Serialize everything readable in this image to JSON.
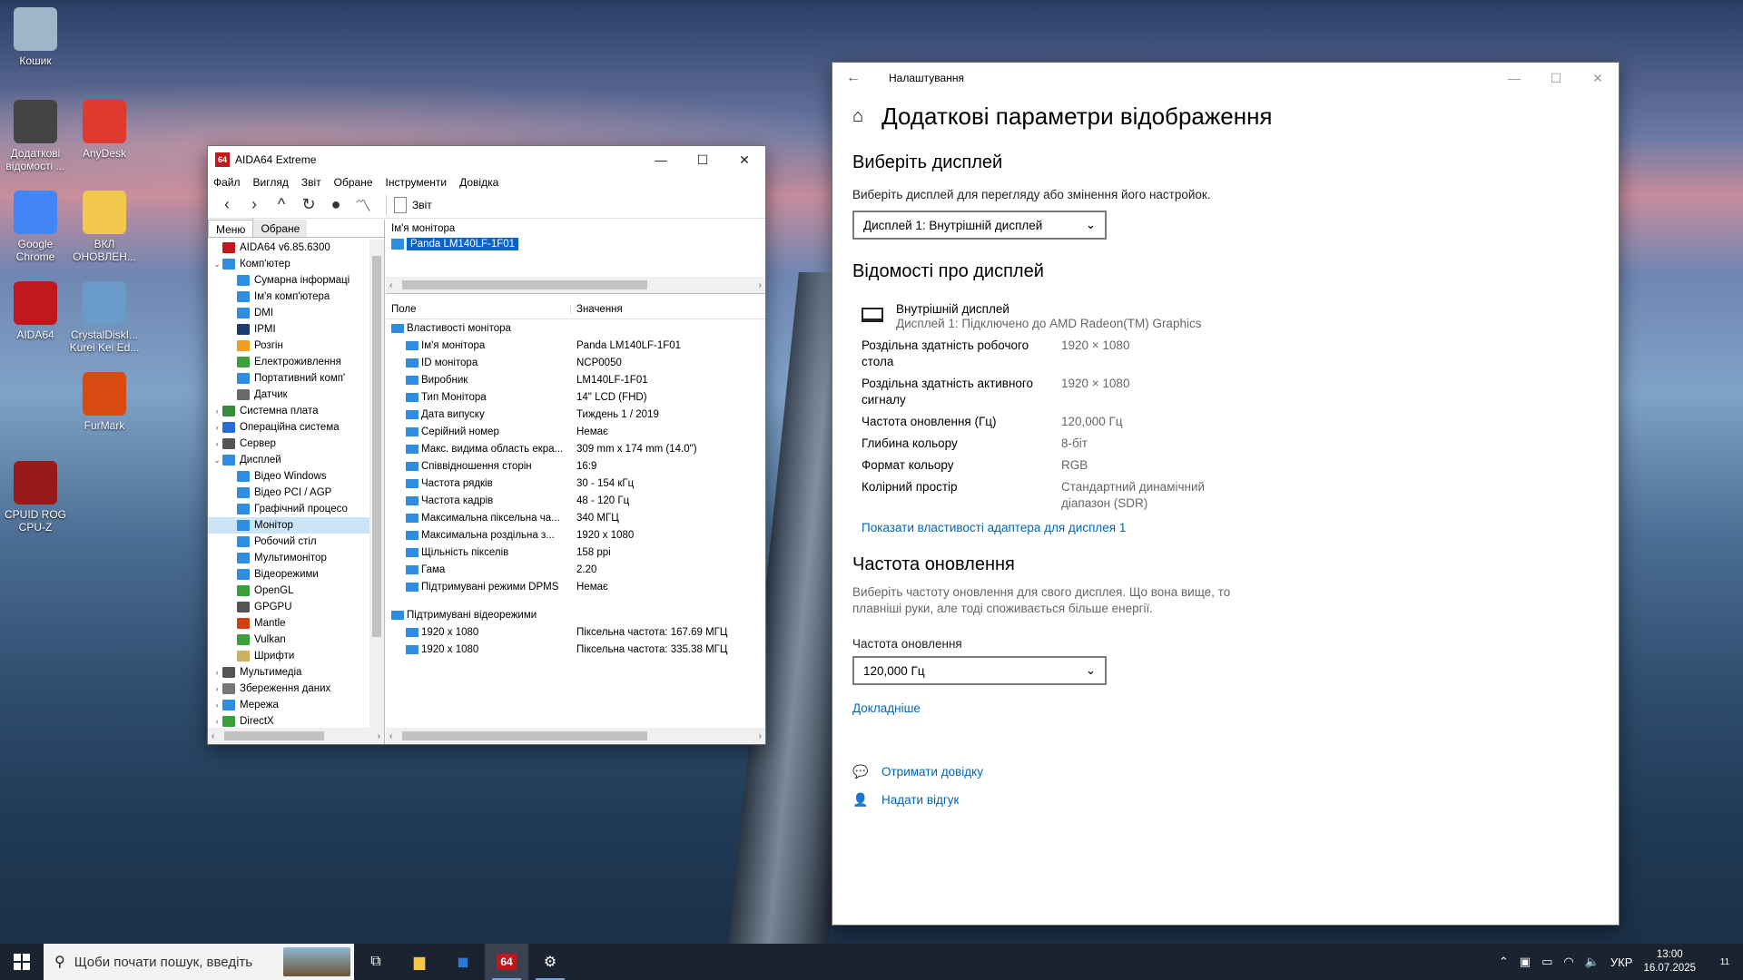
{
  "desktop": {
    "icons": [
      {
        "label": "Кошик",
        "icon": "recycle-bin-icon"
      },
      {
        "label": "Додаткові відомості ...",
        "icon": "display-info-icon"
      },
      {
        "label": "AnyDesk",
        "icon": "anydesk-icon"
      },
      {
        "label": "Google Chrome",
        "icon": "chrome-icon"
      },
      {
        "label": "ВКЛ ОНОВЛЕН...",
        "icon": "folder-icon"
      },
      {
        "label": "AIDA64",
        "icon": "aida64-icon"
      },
      {
        "label": "CrystalDiskI... Kurei Kei Ed...",
        "icon": "crystaldisk-icon"
      },
      {
        "label": "FurMark",
        "icon": "furmark-icon"
      },
      {
        "label": "CPUID ROG CPU-Z",
        "icon": "cpuz-icon"
      }
    ]
  },
  "aida": {
    "title": "AIDA64 Extreme",
    "app_icon_text": "64",
    "menu": [
      "Файл",
      "Вигляд",
      "Звіт",
      "Обране",
      "Інструменти",
      "Довідка"
    ],
    "report_label": "Звіт",
    "tabs": [
      "Меню",
      "Обране"
    ],
    "tree": [
      {
        "label": "AIDA64 v6.85.6300",
        "level": 0,
        "tw": "",
        "color": "#c0181b"
      },
      {
        "label": "Комп'ютер",
        "level": 0,
        "tw": "⌄",
        "color": "#2e8de0"
      },
      {
        "label": "Сумарна інформаці",
        "level": 1,
        "tw": "",
        "color": "#2e8de0"
      },
      {
        "label": "Ім'я комп'ютера",
        "level": 1,
        "tw": "",
        "color": "#2e8de0"
      },
      {
        "label": "DMI",
        "level": 1,
        "tw": "",
        "color": "#2e8de0"
      },
      {
        "label": "IPMI",
        "level": 1,
        "tw": "",
        "color": "#1b3c6e"
      },
      {
        "label": "Розгін",
        "level": 1,
        "tw": "",
        "color": "#f0a020"
      },
      {
        "label": "Електроживлення",
        "level": 1,
        "tw": "",
        "color": "#3aa03a"
      },
      {
        "label": "Портативний комп'",
        "level": 1,
        "tw": "",
        "color": "#2e8de0"
      },
      {
        "label": "Датчик",
        "level": 1,
        "tw": "",
        "color": "#6a6a6a"
      },
      {
        "label": "Системна плата",
        "level": 0,
        "tw": "›",
        "color": "#3a8a3a"
      },
      {
        "label": "Операційна система",
        "level": 0,
        "tw": "›",
        "color": "#2a6ad8"
      },
      {
        "label": "Сервер",
        "level": 0,
        "tw": "›",
        "color": "#555555"
      },
      {
        "label": "Дисплей",
        "level": 0,
        "tw": "⌄",
        "color": "#2e8de0"
      },
      {
        "label": "Відео Windows",
        "level": 1,
        "tw": "",
        "color": "#2e8de0"
      },
      {
        "label": "Відео PCI / AGP",
        "level": 1,
        "tw": "",
        "color": "#2e8de0"
      },
      {
        "label": "Графічний процесо",
        "level": 1,
        "tw": "",
        "color": "#2e8de0"
      },
      {
        "label": "Монітор",
        "level": 1,
        "tw": "",
        "color": "#2e8de0",
        "selected": true
      },
      {
        "label": "Робочий стіл",
        "level": 1,
        "tw": "",
        "color": "#2e8de0"
      },
      {
        "label": "Мультимонітор",
        "level": 1,
        "tw": "",
        "color": "#2e8de0"
      },
      {
        "label": "Відеорежими",
        "level": 1,
        "tw": "",
        "color": "#2e8de0"
      },
      {
        "label": "OpenGL",
        "level": 1,
        "tw": "",
        "color": "#3aa03a"
      },
      {
        "label": "GPGPU",
        "level": 1,
        "tw": "",
        "color": "#555555"
      },
      {
        "label": "Mantle",
        "level": 1,
        "tw": "",
        "color": "#d04010"
      },
      {
        "label": "Vulkan",
        "level": 1,
        "tw": "",
        "color": "#3aa03a"
      },
      {
        "label": "Шрифти",
        "level": 1,
        "tw": "",
        "color": "#d0b060"
      },
      {
        "label": "Мультимедіа",
        "level": 0,
        "tw": "›",
        "color": "#555555"
      },
      {
        "label": "Збереження даних",
        "level": 0,
        "tw": "›",
        "color": "#777777"
      },
      {
        "label": "Мережа",
        "level": 0,
        "tw": "›",
        "color": "#2e8de0"
      },
      {
        "label": "DirectX",
        "level": 0,
        "tw": "›",
        "color": "#3aa03a"
      }
    ],
    "top_header": "Ім'я монітора",
    "top_selected": "Panda LM140LF-1F01",
    "columns": [
      "Поле",
      "Значення"
    ],
    "groups": [
      {
        "title": "Властивості монітора",
        "rows": [
          {
            "field": "Ім'я монітора",
            "value": "Panda LM140LF-1F01"
          },
          {
            "field": "ID монітора",
            "value": "NCP0050"
          },
          {
            "field": "Виробник",
            "value": "LM140LF-1F01"
          },
          {
            "field": "Тип Монітора",
            "value": "14\" LCD (FHD)"
          },
          {
            "field": "Дата випуску",
            "value": "Тиждень 1 / 2019"
          },
          {
            "field": "Серійний номер",
            "value": "Немає"
          },
          {
            "field": "Макс. видима область екра...",
            "value": "309 mm x 174 mm (14.0\")"
          },
          {
            "field": "Співвідношення сторін",
            "value": "16:9"
          },
          {
            "field": "Частота рядків",
            "value": "30 - 154 кГц"
          },
          {
            "field": "Частота кадрів",
            "value": "48 - 120 Гц"
          },
          {
            "field": "Максимальна піксельна ча...",
            "value": "340 МГЦ"
          },
          {
            "field": "Максимальна роздільна з...",
            "value": "1920 x 1080"
          },
          {
            "field": "Щільність пікселів",
            "value": "158 ppi"
          },
          {
            "field": "Гама",
            "value": "2.20"
          },
          {
            "field": "Підтримувані режими DPMS",
            "value": "Немає"
          }
        ]
      },
      {
        "title": "Підтримувані відеорежими",
        "rows": [
          {
            "field": "1920 x 1080",
            "value": "Піксельна частота: 167.69 МГЦ"
          },
          {
            "field": "1920 x 1080",
            "value": "Піксельна частота: 335.38 МГЦ"
          }
        ]
      }
    ]
  },
  "settings": {
    "window_title": "Налаштування",
    "page_title": "Додаткові параметри відображення",
    "choose_display_heading": "Виберіть дисплей",
    "choose_display_desc": "Виберіть дисплей для перегляду або змінення його настройок.",
    "display_select": "Дисплей 1: Внутрішній дисплей",
    "info_heading": "Відомості про дисплей",
    "display_name": "Внутрішній дисплей",
    "display_sub": "Дисплей 1: Підключено до AMD Radeon(TM) Graphics",
    "info": [
      {
        "k": "Роздільна здатність робочого стола",
        "v": "1920 × 1080"
      },
      {
        "k": "Роздільна здатність активного сигналу",
        "v": "1920 × 1080"
      },
      {
        "k": "Частота оновлення (Гц)",
        "v": "120,000 Гц"
      },
      {
        "k": "Глибина кольору",
        "v": "8-біт"
      },
      {
        "k": "Формат кольору",
        "v": "RGB"
      },
      {
        "k": "Колірний простір",
        "v": "Стандартний динамічний діапазон (SDR)"
      }
    ],
    "adapter_link": "Показати властивості адаптера для дисплея 1",
    "refresh_heading": "Частота оновлення",
    "refresh_desc": "Виберіть частоту оновлення для свого дисплея. Що вона вище, то плавніші руки, але тоді споживається більше енергії.",
    "refresh_label": "Частота оновлення",
    "refresh_select": "120,000 Гц",
    "more_link": "Докладніше",
    "help_link": "Отримати довідку",
    "feedback_link": "Надати відгук"
  },
  "taskbar": {
    "search_placeholder": "Щоби почати пошук, введіть",
    "apps": [
      "task-view-icon",
      "file-explorer-icon",
      "outlook-icon",
      "aida64-icon",
      "settings-icon"
    ],
    "lang": "УКР",
    "time": "13:00",
    "date": "16.07.2025",
    "notif_count": "11"
  }
}
